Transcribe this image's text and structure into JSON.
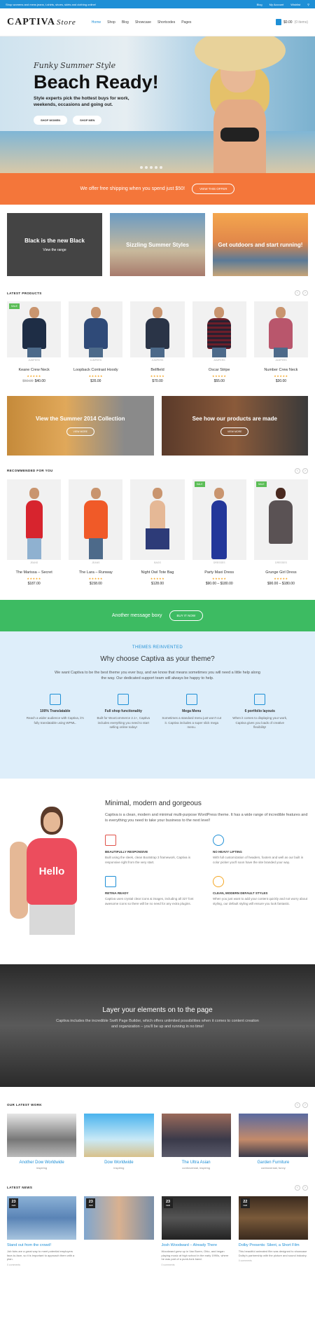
{
  "topbar": {
    "promo": "Shop womens and mens jeans, t-shirts, shoes, skirts and clothing online!",
    "blog": "Blog",
    "account": "My Account",
    "wishlist": "Wishlist"
  },
  "header": {
    "logo_main": "CAPTIVA",
    "logo_script": "Store",
    "nav": [
      "Home",
      "Shop",
      "Blog",
      "Showcase",
      "Shortcodes",
      "Pages"
    ],
    "cart": "$0.00",
    "cart_items": "(0 items)"
  },
  "hero": {
    "subtitle": "Funky Summer Style",
    "title": "Beach Ready!",
    "description": "Style experts pick the hottest buys for work, weekends, occasions and going out.",
    "btn_women": "SHOP WOMEN",
    "btn_men": "SHOP MEN"
  },
  "promo": {
    "text": "We offer free shipping when you spend just $50!",
    "button": "VIEW THIS OFFER"
  },
  "tiles": [
    {
      "title": "Black is the new Black",
      "sub": "View the range"
    },
    {
      "title": "Sizzling Summer Styles",
      "sub": ""
    },
    {
      "title": "Get outdoors and start running!",
      "sub": ""
    }
  ],
  "latest": {
    "heading": "LATEST PRODUCTS",
    "products": [
      {
        "cat": "JUMPERS",
        "name": "Keane Crew Neck",
        "old": "$50.00",
        "price": "$40.00",
        "sale": "SALE"
      },
      {
        "cat": "JUMPERS",
        "name": "Loopback Contrast Hoody",
        "old": "",
        "price": "$35.00",
        "sale": ""
      },
      {
        "cat": "JUMPERS",
        "name": "Bellfield",
        "old": "",
        "price": "$70.00",
        "sale": ""
      },
      {
        "cat": "JUMPERS",
        "name": "Oscar Stripe",
        "old": "",
        "price": "$55.00",
        "sale": ""
      },
      {
        "cat": "JUMPERS",
        "name": "Number Crew Neck",
        "old": "",
        "price": "$30.00",
        "sale": ""
      }
    ]
  },
  "banners": [
    {
      "title": "View the Summer 2014 Collection",
      "button": "VIEW MORE"
    },
    {
      "title": "See how our products are made",
      "button": "VIEW MORE"
    }
  ],
  "recommended": {
    "heading": "RECOMMENDED FOR YOU",
    "products": [
      {
        "cat": "JEANS",
        "name": "The Marissa – Secret",
        "price": "$187.00",
        "sale": ""
      },
      {
        "cat": "JEANS",
        "name": "The Lara – Runway",
        "price": "$158.00",
        "sale": ""
      },
      {
        "cat": "BAGS",
        "name": "Night Owl Tote Bag",
        "price": "$128.00",
        "sale": ""
      },
      {
        "cat": "DRESSES",
        "name": "Party Maxi Dress",
        "price": "$90.00 – $180.00",
        "sale": "SALE"
      },
      {
        "cat": "DRESSES",
        "name": "Grunge Girl Dress",
        "price": "$90.00 – $180.00",
        "sale": "SALE"
      }
    ]
  },
  "message": {
    "text": "Another message boxy",
    "button": "BUY IT NOW"
  },
  "why": {
    "kicker": "THEMES REINVENTED",
    "heading": "Why choose Captiva as your theme?",
    "desc": "We want Captiva to be the best theme you ever buy, and we know that means sometimes you will need a little help along the way. Our dedicated support team will always be happy to help.",
    "features": [
      {
        "title": "100% Translatable",
        "desc": "Reach a wider audience with Captiva, it's fully translatable using WPML."
      },
      {
        "title": "Full shop functionality",
        "desc": "Built for WooCommerce 2.1+, Captiva includes everything you need to start selling online today!"
      },
      {
        "title": "Mega Menu",
        "desc": "Sometimes a standard menu just won't cut it. Captiva includes a super slick mega menu."
      },
      {
        "title": "6 portfolio layouts",
        "desc": "When it comes to displaying your work, Captiva gives you loads of creative flexibility!"
      }
    ]
  },
  "minimal": {
    "heading": "Minimal, modern and gorgeous",
    "desc": "Captiva is a clean, modern and minimal multi-purpose WordPress theme. It has a wide range of incredible features and is everything you need to take your business to the next level!",
    "hello": "Hello",
    "items": [
      {
        "title": "BEAUTIFULLY RESPONSIVE",
        "desc": "Built using the sleek, clean Bootstrap 3 framework, Captiva is responsive right from the very start."
      },
      {
        "title": "NO HEAVY LIFTING",
        "desc": "With full customization of headers, footers and well as our built in color picker you'll soon have the site branded your way."
      },
      {
        "title": "RETINA READY",
        "desc": "Captiva uses crystal clear icons & images, including all 327 font awesome icons so there will be no need for any extra plugins."
      },
      {
        "title": "CLEAN, MODERN DEFAULT STYLES",
        "desc": "When you just want to add your content quickly and not worry about styling, our default styling will ensure you look fantastic."
      }
    ]
  },
  "layer": {
    "heading": "Layer your elements on to the page",
    "desc": "Captiva includes the incredible Swift Page Builder, which offers unlimited possibilities when it comes to content creation and organization – you'll be up and running in no time!"
  },
  "work": {
    "heading": "OUR LATEST WORK",
    "items": [
      {
        "title": "Another Dow Worldwide",
        "cat": "inspiring"
      },
      {
        "title": "Dow Worldwide",
        "cat": "inspiring"
      },
      {
        "title": "The Ultra Asian",
        "cat": "controversial, inspiring"
      },
      {
        "title": "Garden Furniture",
        "cat": "controversial, funny"
      }
    ]
  },
  "news": {
    "heading": "LATEST NEWS",
    "items": [
      {
        "day": "23",
        "mon": "FEB",
        "title": "Stand out from the crowd!",
        "desc": "Job fairs are a great way to meet potential employers face-to-face, so it is important to approach them with a plan.",
        "meta": "0 comments"
      },
      {
        "day": "23",
        "mon": "FEB",
        "title": "",
        "desc": "",
        "meta": ""
      },
      {
        "day": "23",
        "mon": "FEB",
        "title": "Josh Woodward – Already There",
        "desc": "Woodward grew up in Van Buren, Ohio, and began playing music at high school in the early 1990s, where he was part of a punk-funk band.",
        "meta": "0 comments"
      },
      {
        "day": "22",
        "mon": "FEB",
        "title": "Dolby Presents: Silent, a Short Film",
        "desc": "This beautiful animated film was designed to showcase Dolby's partnership with the picture and sound industry.",
        "meta": "0 comments"
      }
    ]
  },
  "colors": {
    "blue": "#1e8fd6",
    "orange": "#f4763a",
    "green": "#3dbb62",
    "star": "#f4a623"
  }
}
